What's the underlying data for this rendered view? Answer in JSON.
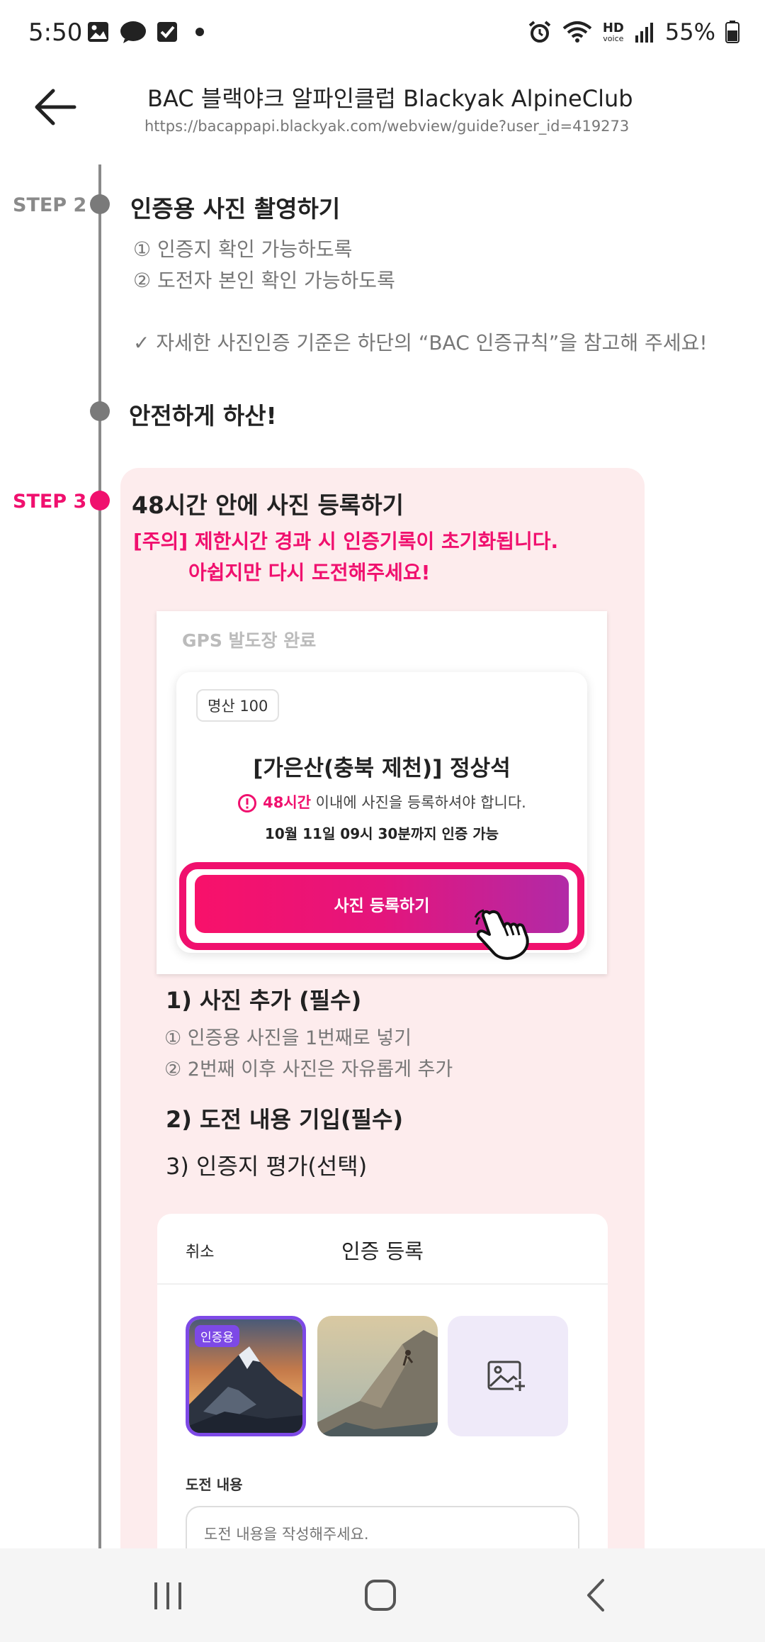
{
  "status_bar": {
    "time": "5:50",
    "battery": "55%",
    "left_icons": [
      "gallery-icon",
      "messenger-icon",
      "check-icon",
      "dot-icon"
    ],
    "right_icons": [
      "alarm-icon",
      "wifi-icon",
      "hd-voice-icon",
      "signal-icon",
      "battery-icon"
    ],
    "hd_label": "HD",
    "voice_label": "voice"
  },
  "header": {
    "title": "BAC 블랙야크 알파인클럽 Blackyak AlpineClub",
    "url": "https://bacappapi.blackyak.com/webview/guide?user_id=419273"
  },
  "step2": {
    "label": "STEP 2",
    "title": "인증용 사진 촬영하기",
    "items": [
      "① 인증지 확인 가능하도록",
      "② 도전자 본인 확인 가능하도록"
    ],
    "note": "✓ 자세한 사진인증 기준은 하단의 “BAC 인증규칙”을 참고해 주세요!",
    "descent_title": "안전하게 하산!"
  },
  "step3": {
    "label": "STEP 3",
    "title": "48시간 안에 사진 등록하기",
    "warning_line1": "[주의] 제한시간 경과 시 인증기록이 초기화됩니다.",
    "warning_line2": "아쉽지만 다시 도전해주세요!"
  },
  "mock_card": {
    "title": "GPS 발도장 완료",
    "badge": "명산 100",
    "mountain": "[가은산(충북 제천)] 정상석",
    "notice_highlight": "48시간",
    "notice_rest": " 이내에 사진을 등록하셔야 합니다.",
    "deadline": "10월 11일 09시 30분까지 인증 가능",
    "cta": "사진 등록하기"
  },
  "guide_list": {
    "s1_title": "1) 사진 추가 (필수)",
    "s1_items": [
      "① 인증용 사진을 1번째로 넣기",
      "② 2번째 이후 사진은 자유롭게 추가"
    ],
    "s2_title": "2) 도전 내용 기입(필수)",
    "s3_title": "3) 인증지 평가(선택)"
  },
  "form_card": {
    "cancel": "취소",
    "title": "인증 등록",
    "thumb_tag": "인증용",
    "field_label": "도전 내용",
    "field_placeholder": "도전 내용을 작성해주세요."
  },
  "colors": {
    "accent_pink": "#f0106e",
    "purple": "#7d49e6",
    "panel_bg": "#fdeced",
    "timeline_gray": "#8a8a8a"
  },
  "nav_bar": {
    "icons": [
      "recent-apps-icon",
      "home-icon",
      "back-icon"
    ]
  }
}
